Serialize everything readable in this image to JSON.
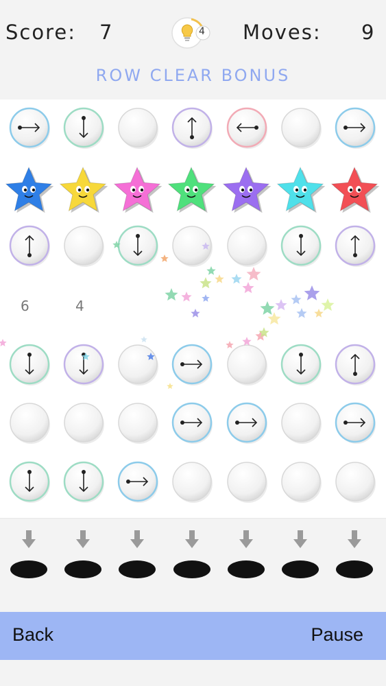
{
  "hud": {
    "score_label": "Score:",
    "score_value": "7",
    "moves_label": "Moves:",
    "moves_value": "9",
    "hints_count": "4",
    "bonus_text": "ROW CLEAR BONUS"
  },
  "grid": {
    "rows": [
      [
        {
          "type": "arrow",
          "dir": "right",
          "ring": "#8ccbea"
        },
        {
          "type": "arrow",
          "dir": "down",
          "ring": "#9ddcc4"
        },
        {
          "type": "plain"
        },
        {
          "type": "arrow",
          "dir": "up",
          "ring": "#c1b1e8"
        },
        {
          "type": "arrow",
          "dir": "left",
          "ring": "#f2aab5"
        },
        {
          "type": "plain"
        },
        {
          "type": "arrow",
          "dir": "right",
          "ring": "#8ccbea"
        }
      ],
      [
        {
          "type": "star",
          "color": "#2f7fe6"
        },
        {
          "type": "star",
          "color": "#f7d83a"
        },
        {
          "type": "star",
          "color": "#f56fd6"
        },
        {
          "type": "star",
          "color": "#4fe07c"
        },
        {
          "type": "star",
          "color": "#9b6ef0"
        },
        {
          "type": "star",
          "color": "#4fe0ea"
        },
        {
          "type": "star",
          "color": "#f24f55"
        }
      ],
      [
        {
          "type": "arrow",
          "dir": "up",
          "ring": "#c1b1e8"
        },
        {
          "type": "plain"
        },
        {
          "type": "arrow",
          "dir": "down",
          "ring": "#9ddcc4"
        },
        {
          "type": "plain"
        },
        {
          "type": "plain"
        },
        {
          "type": "arrow",
          "dir": "down",
          "ring": "#9ddcc4"
        },
        {
          "type": "arrow",
          "dir": "up",
          "ring": "#c1b1e8"
        }
      ],
      [
        {
          "type": "empty"
        },
        {
          "type": "empty"
        },
        {
          "type": "empty"
        },
        {
          "type": "empty"
        },
        {
          "type": "empty"
        },
        {
          "type": "empty"
        },
        {
          "type": "empty"
        }
      ],
      [
        {
          "type": "arrow",
          "dir": "down",
          "ring": "#9ddcc4"
        },
        {
          "type": "arrow",
          "dir": "down",
          "ring": "#c1b1e8"
        },
        {
          "type": "plain"
        },
        {
          "type": "arrow",
          "dir": "right",
          "ring": "#8ccbea"
        },
        {
          "type": "plain"
        },
        {
          "type": "arrow",
          "dir": "down",
          "ring": "#9ddcc4"
        },
        {
          "type": "arrow",
          "dir": "up",
          "ring": "#c1b1e8"
        }
      ],
      [
        {
          "type": "plain"
        },
        {
          "type": "plain"
        },
        {
          "type": "plain"
        },
        {
          "type": "arrow",
          "dir": "right",
          "ring": "#8ccbea"
        },
        {
          "type": "arrow",
          "dir": "right",
          "ring": "#8ccbea"
        },
        {
          "type": "plain"
        },
        {
          "type": "arrow",
          "dir": "right",
          "ring": "#8ccbea"
        }
      ],
      [
        {
          "type": "arrow",
          "dir": "down",
          "ring": "#9ddcc4"
        },
        {
          "type": "arrow",
          "dir": "down",
          "ring": "#9ddcc4"
        },
        {
          "type": "arrow",
          "dir": "right",
          "ring": "#8ccbea"
        },
        {
          "type": "plain"
        },
        {
          "type": "plain"
        },
        {
          "type": "plain"
        },
        {
          "type": "plain"
        }
      ]
    ],
    "floating_numbers": [
      "6",
      "4"
    ]
  },
  "drop_columns": 7,
  "footer": {
    "back_label": "Back",
    "pause_label": "Pause"
  },
  "colors": {
    "bonus_text": "#8fa8f0",
    "footer_bar": "#9db6f4",
    "hole": "#111111",
    "drop_arrow": "#9a9a9a"
  }
}
